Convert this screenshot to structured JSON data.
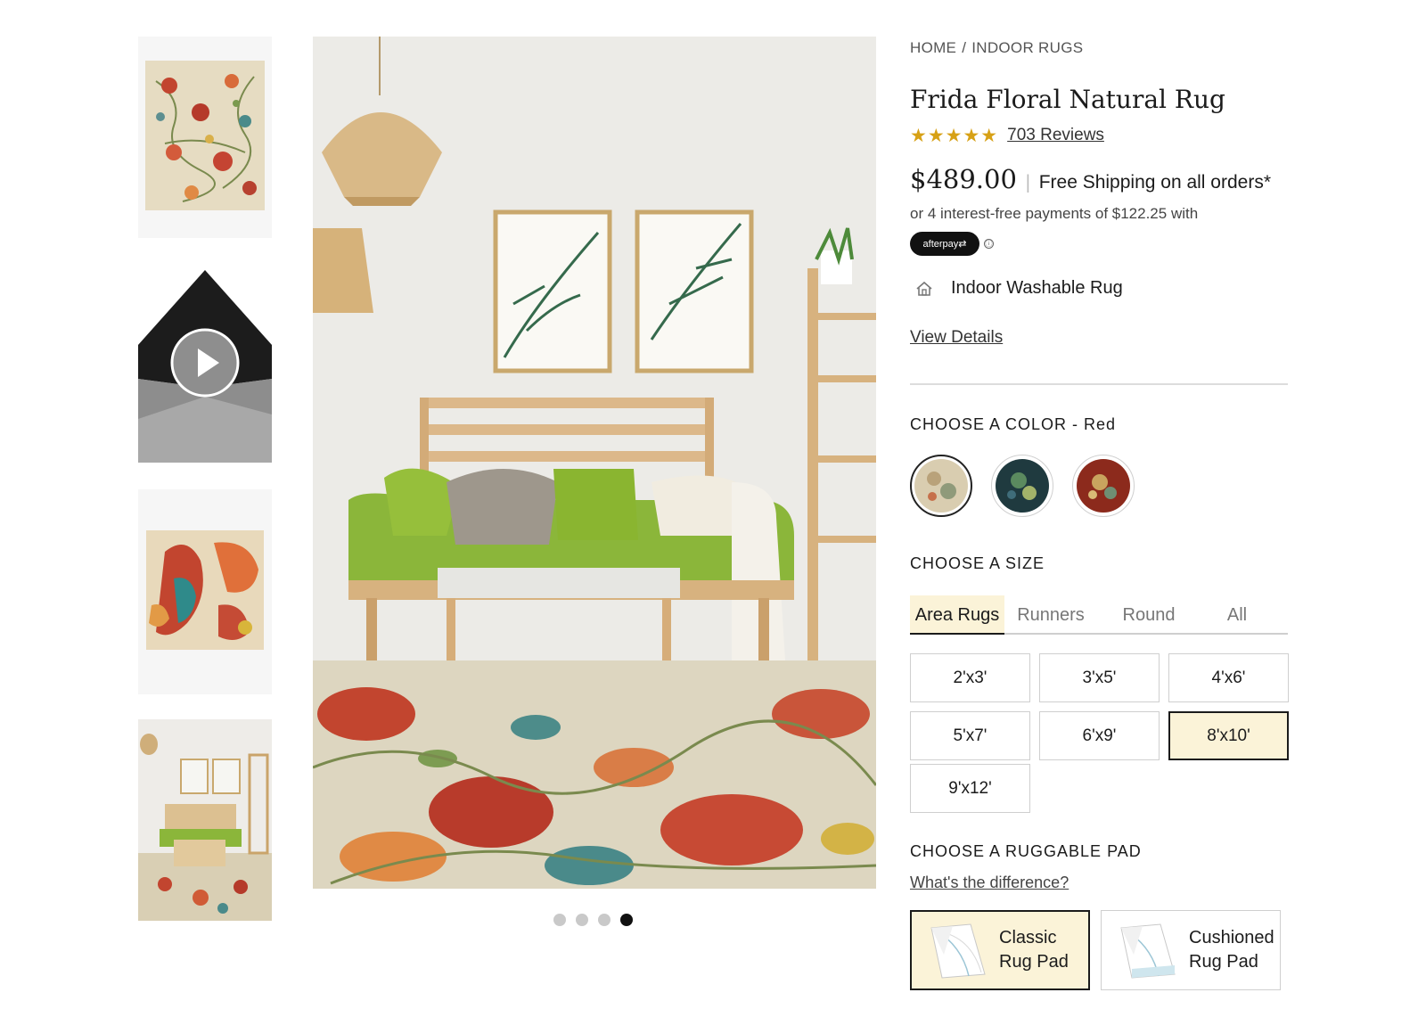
{
  "breadcrumb": [
    {
      "label": "HOME"
    },
    {
      "label": "INDOOR RUGS"
    }
  ],
  "product": {
    "title": "Frida Floral Natural Rug",
    "rating": 4.5,
    "rating_stars": "★★★★★",
    "reviews_label": "703 Reviews",
    "price": "$489.00",
    "shipping": "Free Shipping on all orders*",
    "afterpay_text": "or 4 interest-free payments of $122.25 with",
    "afterpay_badge": "afterpay⇄",
    "info_icon": "ⓘ",
    "feature": {
      "icon": "house-icon",
      "label": "Indoor Washable Rug"
    },
    "view_details": "View Details"
  },
  "color": {
    "heading": "CHOOSE A COLOR - Red",
    "swatches": [
      {
        "name": "natural",
        "color": "#d9cdb0",
        "selected": true
      },
      {
        "name": "blue",
        "color": "#1f3a3f",
        "selected": false
      },
      {
        "name": "red",
        "color": "#8c2a1c",
        "selected": false
      }
    ]
  },
  "size": {
    "heading": "CHOOSE A SIZE",
    "tabs": [
      {
        "label": "Area Rugs",
        "active": true
      },
      {
        "label": "Runners",
        "active": false
      },
      {
        "label": "Round",
        "active": false
      },
      {
        "label": "All",
        "active": false
      }
    ],
    "options": [
      {
        "label": "2'x3'",
        "selected": false
      },
      {
        "label": "3'x5'",
        "selected": false
      },
      {
        "label": "4'x6'",
        "selected": false
      },
      {
        "label": "5'x7'",
        "selected": false
      },
      {
        "label": "6'x9'",
        "selected": false
      },
      {
        "label": "8'x10'",
        "selected": true
      },
      {
        "label": "9'x12'",
        "selected": false
      }
    ]
  },
  "pad": {
    "heading": "CHOOSE A RUGGABLE PAD",
    "link": "What's the difference?",
    "options": [
      {
        "line1": "Classic",
        "line2": "Rug Pad",
        "selected": true
      },
      {
        "line1": "Cushioned",
        "line2": "Rug Pad",
        "selected": false
      }
    ]
  },
  "gallery": {
    "thumbnail_count": 4,
    "dots": [
      false,
      false,
      false,
      true
    ],
    "active_index": 3
  },
  "colors": {
    "accent_selected": "#fbf3d8",
    "star": "#d7a116",
    "text": "#1b1b1b"
  }
}
